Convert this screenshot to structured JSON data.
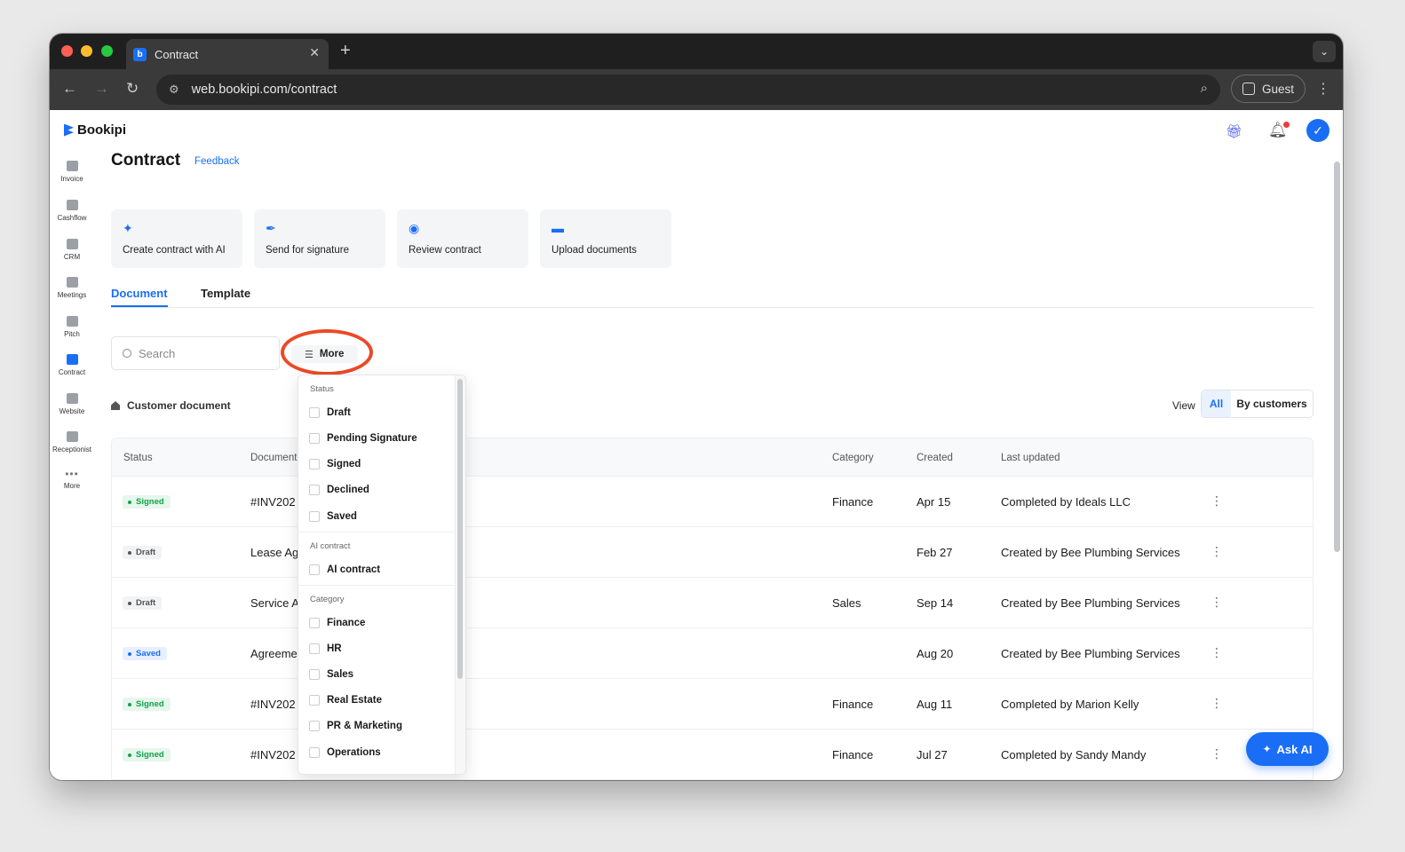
{
  "browser": {
    "tab_title": "Contract",
    "url": "web.bookipi.com/contract",
    "profile": "Guest"
  },
  "app": {
    "brand": "Bookipi",
    "page_title": "Contract",
    "feedback": "Feedback"
  },
  "sidebar": {
    "items": [
      {
        "label": "Invoice"
      },
      {
        "label": "Cashflow"
      },
      {
        "label": "CRM"
      },
      {
        "label": "Meetings"
      },
      {
        "label": "Pitch"
      },
      {
        "label": "Contract"
      },
      {
        "label": "Website"
      },
      {
        "label": "Receptionist"
      },
      {
        "label": "More"
      }
    ]
  },
  "actions": [
    {
      "label": "Create contract with AI",
      "icon": "sparkle-icon"
    },
    {
      "label": "Send for signature",
      "icon": "pen-icon"
    },
    {
      "label": "Review contract",
      "icon": "eye-icon"
    },
    {
      "label": "Upload documents",
      "icon": "folder-icon"
    }
  ],
  "tabs": [
    "Document",
    "Template"
  ],
  "search": {
    "placeholder": "Search"
  },
  "filter_button": "More",
  "section_label": "Customer document",
  "view": {
    "label": "View",
    "all": "All",
    "by_customers": "By customers"
  },
  "table": {
    "headers": [
      "Status",
      "Document",
      "Category",
      "Created",
      "Last updated"
    ],
    "rows": [
      {
        "status": "Signed",
        "document": "#INV202",
        "category": "Finance",
        "created": "Apr 15",
        "updated": "Completed by Ideals LLC"
      },
      {
        "status": "Draft",
        "document": "Lease Ag",
        "category": "",
        "created": "Feb 27",
        "updated": "Created by Bee Plumbing Services"
      },
      {
        "status": "Draft",
        "document": "Service A",
        "category": "Sales",
        "created": "Sep 14",
        "updated": "Created by Bee Plumbing Services"
      },
      {
        "status": "Saved",
        "document": "Agreeme",
        "category": "",
        "created": "Aug 20",
        "updated": "Created by Bee Plumbing Services"
      },
      {
        "status": "Signed",
        "document": "#INV202",
        "category": "Finance",
        "created": "Aug 11",
        "updated": "Completed by Marion Kelly"
      },
      {
        "status": "Signed",
        "document": "#INV202",
        "category": "Finance",
        "created": "Jul 27",
        "updated": "Completed by Sandy Mandy"
      }
    ]
  },
  "dropdown": {
    "status_title": "Status",
    "status_options": [
      "Draft",
      "Pending Signature",
      "Signed",
      "Declined",
      "Saved"
    ],
    "ai_title": "AI contract",
    "ai_options": [
      "AI contract"
    ],
    "category_title": "Category",
    "category_options": [
      "Finance",
      "HR",
      "Sales",
      "Real Estate",
      "PR & Marketing",
      "Operations"
    ]
  },
  "ask_ai": "Ask AI",
  "colors": {
    "accent": "#1a6ef5",
    "highlight_ring": "#ea4a26"
  }
}
